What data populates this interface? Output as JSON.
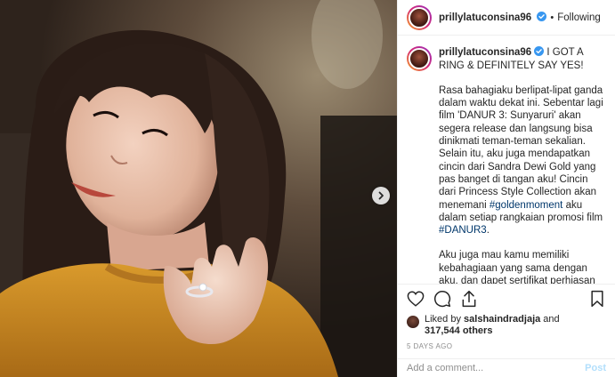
{
  "post": {
    "username": "prillylatuconsina96",
    "follow_label": "Following",
    "dot": "•",
    "caption": {
      "username": "prillylatuconsina96",
      "headline": "I GOT A RING & DEFINITELY SAY YES!",
      "para1_a": "Rasa bahagiaku berlipat-lipat ganda dalam waktu dekat ini. Sebentar lagi film 'DANUR 3: Sunyaruri' akan segera release dan langsung bisa dinikmati teman-teman sekalian. Selain itu, aku juga mendapatkan cincin dari Sandra Dewi Gold yang pas banget di tangan aku! Cincin dari Princess Style Collection akan menemani ",
      "hashtag1": "#goldenmoment",
      "para1_b": " aku dalam setiap rangkaian promosi film ",
      "hashtag2": "#DANUR3",
      "para1_c": ".",
      "para2": "Aku juga mau kamu memiliki kebahagiaan yang sama dengan aku, dan dapet sertifikat perhiasan emas"
    },
    "likes": {
      "prefix": "Liked by ",
      "user": "salshaindradjaja",
      "and": " and",
      "count": "317,544 others"
    },
    "time": "5 DAYS AGO",
    "comment_placeholder": "Add a comment...",
    "post_label": "Post"
  },
  "icons": {
    "heart": "heart-icon",
    "comment": "comment-icon",
    "share": "share-icon",
    "save": "bookmark-icon",
    "next": "chevron-right-icon",
    "verified": "verified-badge-icon"
  },
  "colors": {
    "text": "#262626",
    "muted": "#8e8e8e",
    "link": "#00376b",
    "verified": "#3897f0",
    "post_button": "#b2dffc"
  }
}
